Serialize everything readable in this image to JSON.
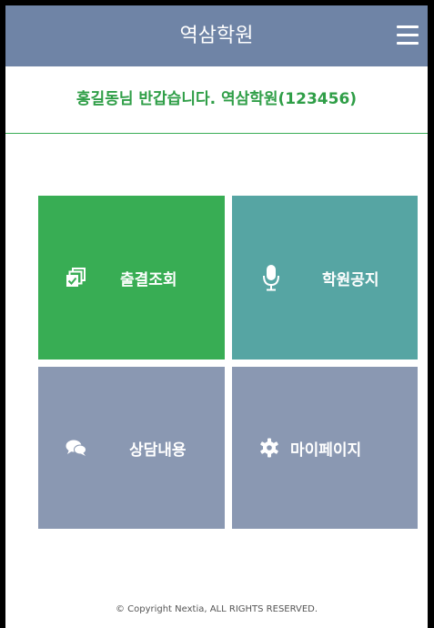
{
  "header": {
    "title": "역삼학원",
    "menu_icon": "hamburger-menu-icon"
  },
  "greeting": {
    "text": "홍길동님 반갑습니다. 역삼학원(123456)"
  },
  "tiles": [
    {
      "label": "출결조회",
      "icon": "attendance-icon",
      "color": "#38ad54"
    },
    {
      "label": "학원공지",
      "icon": "microphone-icon",
      "color": "#56a5a3"
    },
    {
      "label": "상담내용",
      "icon": "chat-bubbles-icon",
      "color": "#8a98b2"
    },
    {
      "label": "마이페이지",
      "icon": "gear-icon",
      "color": "#8a98b2"
    }
  ],
  "footer": {
    "copyright": "© Copyright Nextia, ALL RIGHTS RESERVED."
  }
}
